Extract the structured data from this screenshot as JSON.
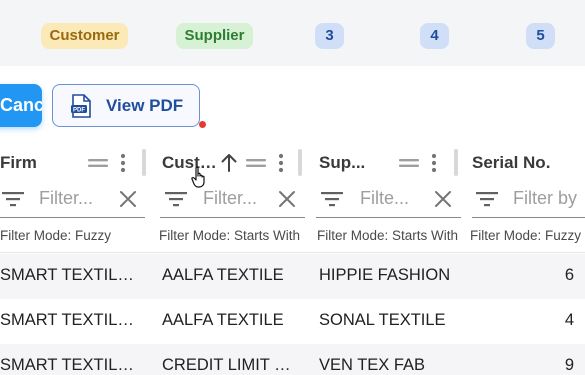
{
  "legend": {
    "customer": "Customer",
    "supplier": "Supplier",
    "n3": "3",
    "n4": "4",
    "n5": "5"
  },
  "toolbar": {
    "cancel_label": "Cancel",
    "pdf_label": "View PDF",
    "pdf_icon_text": "PDF"
  },
  "columns": [
    {
      "title": "Firm",
      "filter_placeholder": "Filter...",
      "filter_mode": "Filter Mode: Fuzzy"
    },
    {
      "title": "Customer",
      "filter_placeholder": "Filter...",
      "filter_mode": "Filter Mode: Starts With"
    },
    {
      "title": "Sup...",
      "filter_placeholder": "Filte...",
      "filter_mode": "Filter Mode: Starts With"
    },
    {
      "title": "Serial No.",
      "filter_placeholder": "Filter by",
      "filter_mode": "Filter Mode: Fuzzy"
    }
  ],
  "rows": [
    {
      "firm": "SMART TEXTILES",
      "customer": "AALFA TEXTILE",
      "supplier": "HIPPIE FASHION",
      "serial": "6"
    },
    {
      "firm": "SMART TEXTILES",
      "customer": "AALFA TEXTILE",
      "supplier": "SONAL TEXTILE",
      "serial": "4"
    },
    {
      "firm": "SMART TEXTILES",
      "customer": "CREDIT LIMIT CUSTOMER",
      "supplier": "VEN TEX FAB",
      "serial": "9"
    }
  ],
  "colors": {
    "primary": "#2196f3",
    "pdf_border": "#6c8fd6",
    "customer_chip": "#fbe9b8",
    "supplier_chip": "#d6f1d4",
    "number_chip": "#d0def7",
    "indicator_dot": "#e53935"
  },
  "icons": {
    "column_drag": "drag-handle-icon",
    "column_menu": "more-vert-icon",
    "sort": "arrow-up-icon",
    "filter": "filter-list-icon",
    "clear": "close-icon",
    "pdf": "pdf-file-icon",
    "cursor": "hand-pointer-icon"
  }
}
